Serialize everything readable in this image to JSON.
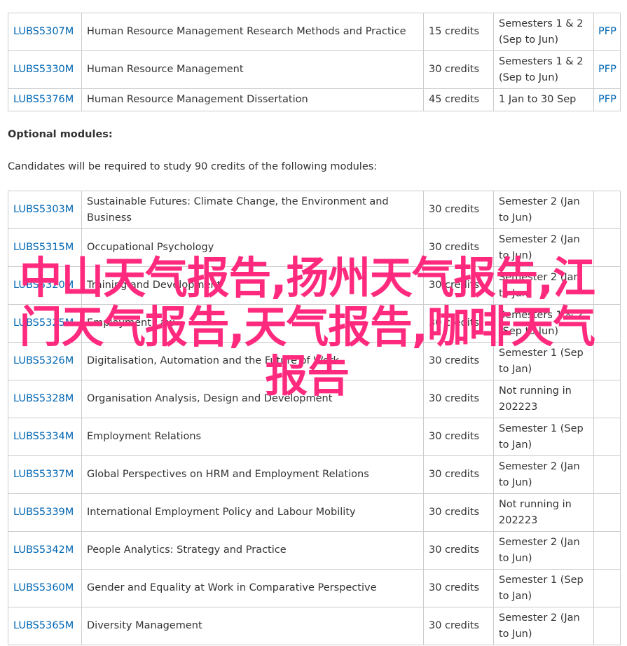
{
  "required_modules": [
    {
      "code": "LUBS5307M",
      "title": "Human Resource Management Research Methods and Practice",
      "credits": "15 credits",
      "semester": "Semesters 1 & 2 (Sep to Jun)",
      "pfp": "PFP"
    },
    {
      "code": "LUBS5330M",
      "title": "Human Resource Management",
      "credits": "30 credits",
      "semester": "Semesters 1 & 2 (Sep to Jun)",
      "pfp": "PFP"
    },
    {
      "code": "LUBS5376M",
      "title": "Human Resource Management Dissertation",
      "credits": "45 credits",
      "semester": "1 Jan to 30 Sep",
      "pfp": "PFP"
    }
  ],
  "optional": {
    "heading": "Optional modules:",
    "intro": "Candidates will be required to study 90 credits of the following modules:"
  },
  "optional_modules": [
    {
      "code": "LUBS5303M",
      "title": "Sustainable Futures: Climate Change, the Environment and Business",
      "credits": "30 credits",
      "semester": "Semester 2 (Jan to Jun)"
    },
    {
      "code": "LUBS5315M",
      "title": "Occupational Psychology",
      "credits": "30 credits",
      "semester": "Semester 2 (Jan to Jun)"
    },
    {
      "code": "LUBS5320M",
      "title": "Training and Development",
      "credits": "30 credits",
      "semester": "Semester 2 (Jan to Jun)"
    },
    {
      "code": "LUBS5325M",
      "title": "Employment Law",
      "credits": "30 credits",
      "semester": "Semesters 1 & 2 (Sep to Jun)"
    },
    {
      "code": "LUBS5326M",
      "title": "Digitalisation, Automation and the Future of Work",
      "credits": "30 credits",
      "semester": "Semester 1 (Sep to Jan)"
    },
    {
      "code": "LUBS5328M",
      "title": "Organisation Analysis, Design and Development",
      "credits": "30 credits",
      "semester": "Not running in 202223"
    },
    {
      "code": "LUBS5334M",
      "title": "Employment Relations",
      "credits": "30 credits",
      "semester": "Semester 1 (Sep to Jan)"
    },
    {
      "code": "LUBS5337M",
      "title": "Global Perspectives on HRM and Employment Relations",
      "credits": "30 credits",
      "semester": "Semester 2 (Jan to Jun)"
    },
    {
      "code": "LUBS5339M",
      "title": "International Employment Policy and Labour Mobility",
      "credits": "30 credits",
      "semester": "Not running in 202223"
    },
    {
      "code": "LUBS5342M",
      "title": "People Analytics: Strategy and Practice",
      "credits": "30 credits",
      "semester": "Semester 2 (Jan to Jun)"
    },
    {
      "code": "LUBS5360M",
      "title": "Gender and Equality at Work in Comparative Perspective",
      "credits": "30 credits",
      "semester": "Semester 1 (Sep to Jan)"
    },
    {
      "code": "LUBS5365M",
      "title": "Diversity Management",
      "credits": "30 credits",
      "semester": "Semester 2 (Jan to Jun)"
    }
  ],
  "overlay_text": "中山天气报告,扬州天气报告,江门天气报告,天气报告,咖啡天气报告",
  "colors": {
    "link": "#0066b3",
    "border": "#cccccc",
    "text": "#333333",
    "overlay": "#ff2a7e"
  }
}
